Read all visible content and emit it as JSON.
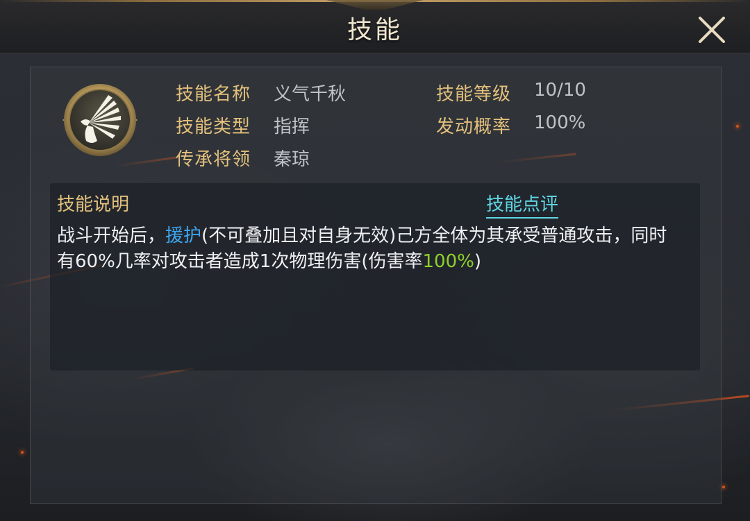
{
  "window": {
    "title": "技能"
  },
  "skill": {
    "icon": "fan-hand-icon",
    "fields": {
      "name_label": "技能名称",
      "name_value": "义气千秋",
      "type_label": "技能类型",
      "type_value": "指挥",
      "inherit_label": "传承将领",
      "inherit_value": "秦琼",
      "level_label": "技能等级",
      "level_value": "10/10",
      "rate_label": "发动概率",
      "rate_value": "100%"
    }
  },
  "description": {
    "heading": "技能说明",
    "review_link": "技能点评",
    "text_part1": "战斗开始后，",
    "keyword": "援护",
    "text_part2": "(不可叠加且对自身无效)己方全体为其承受普通攻击，同时有60%几率对攻击者造成1次物理伤害(伤害率",
    "damage_rate": "100%",
    "text_part3": ")"
  },
  "colors": {
    "label_gold": "#e3c07c",
    "value_gray": "#bfc2c7",
    "keyword_blue": "#3ea6f0",
    "rate_green": "#8fd12a",
    "link_cyan": "#5fd7e4"
  }
}
